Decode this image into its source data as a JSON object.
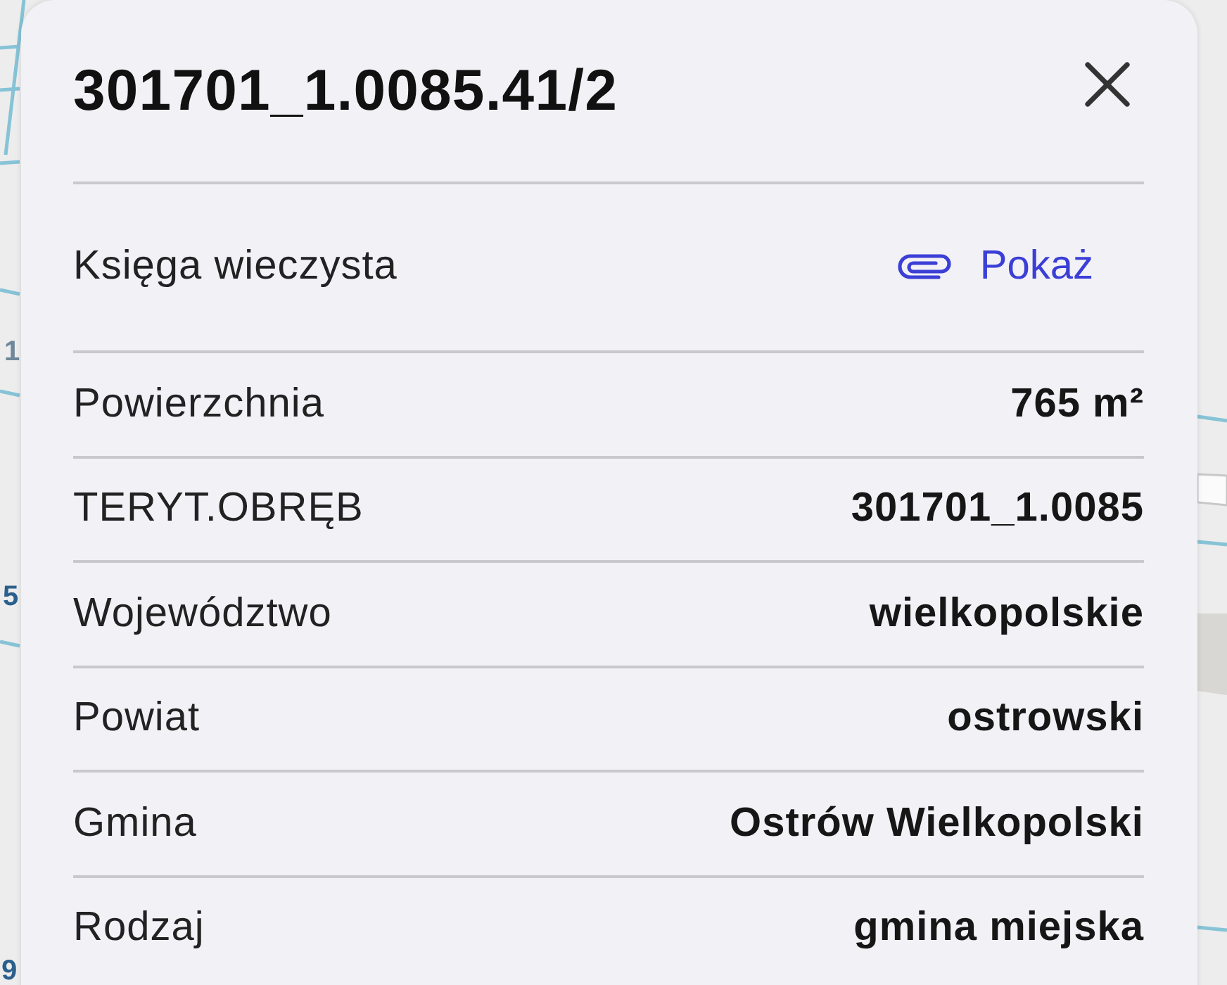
{
  "map": {
    "labels": [
      {
        "text": "1",
        "color": "#6f8799"
      },
      {
        "text": "5",
        "color": "#2b5f8c"
      },
      {
        "text": "9",
        "color": "#2b5f8c"
      }
    ]
  },
  "panel": {
    "title": "301701_1.0085.41/2",
    "rows": [
      {
        "kind": "link",
        "label": "Księga wieczysta",
        "value": "Pokaż"
      },
      {
        "kind": "text",
        "label": "Powierzchnia",
        "value": "765 m²"
      },
      {
        "kind": "text",
        "label": "TERYT.OBRĘB",
        "value": "301701_1.0085"
      },
      {
        "kind": "text",
        "label": "Województwo",
        "value": "wielkopolskie"
      },
      {
        "kind": "text",
        "label": "Powiat",
        "value": "ostrowski"
      },
      {
        "kind": "text",
        "label": "Gmina",
        "value": "Ostrów Wielkopolski"
      },
      {
        "kind": "text",
        "label": "Rodzaj",
        "value": "gmina miejska"
      }
    ]
  }
}
